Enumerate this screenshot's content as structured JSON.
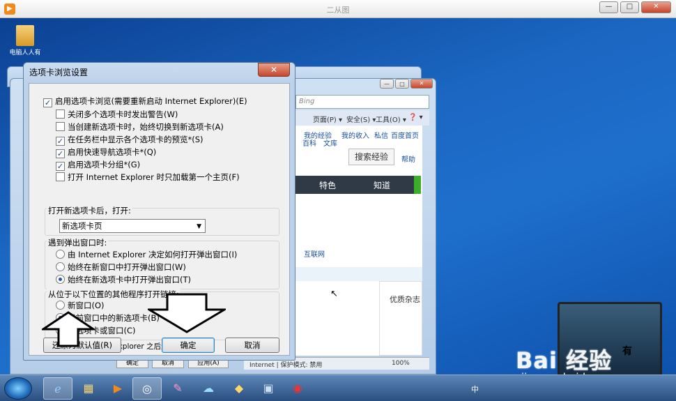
{
  "outer_window": {
    "title": "二从图",
    "min": "—",
    "max": "□",
    "close": "✕"
  },
  "desktop_icon": {
    "label": "电脑人人有"
  },
  "bg_window": {
    "search_hint": "Bing",
    "menu": [
      "页面(P) ▾",
      "安全(S) ▾",
      "工具(O) ▾",
      "❓ ▾"
    ],
    "links": [
      "我的经验",
      "我的收入",
      "私信",
      "百度首页",
      "百科",
      "文库"
    ],
    "search_button": "搜索经验",
    "help": "帮助",
    "nav": [
      "特色",
      "知道"
    ],
    "link_text": "互联网",
    "card_text": "优质杂志",
    "status": "Internet | 保护模式: 禁用",
    "zoom": "100%",
    "bottom_buttons": [
      "确定",
      "取消",
      "应用(A)"
    ]
  },
  "dialog": {
    "title": "选项卡浏览设置",
    "close": "✕",
    "main_checkbox": "启用选项卡浏览(需要重新启动 Internet Explorer)(E)",
    "options": [
      {
        "label": "关闭多个选项卡时发出警告(W)",
        "checked": false
      },
      {
        "label": "当创建新选项卡时，始终切换到新选项卡(A)",
        "checked": false
      },
      {
        "label": "在任务栏中显示各个选项卡的预览*(S)",
        "checked": true
      },
      {
        "label": "启用快速导航选项卡*(Q)",
        "checked": true
      },
      {
        "label": "启用选项卡分组*(G)",
        "checked": true
      },
      {
        "label": "打开 Internet Explorer 时只加载第一个主页(F)",
        "checked": false
      }
    ],
    "new_tab_group": "打开新选项卡后，打开:",
    "new_tab_select": "新选项卡页",
    "popup_group": "遇到弹出窗口时:",
    "popup_options": [
      {
        "label": "由 Internet Explorer 决定如何打开弹出窗口(I)",
        "selected": false
      },
      {
        "label": "始终在新窗口中打开弹出窗口(W)",
        "selected": false
      },
      {
        "label": "始终在新选项卡中打开弹出窗口(T)",
        "selected": true
      }
    ],
    "links_group": "从位于以下位置的其他程序打开链接:",
    "links_options": [
      {
        "label": "新窗口(O)",
        "selected": false
      },
      {
        "label": "当前窗口中的新选项卡(B)",
        "selected": true
      },
      {
        "label": "新选项卡或窗口(C)",
        "selected": false
      }
    ],
    "note": "* 重新启动 Internet Explorer 之后生效",
    "restore_button": "还原为默认值(R)",
    "ok_button": "确定",
    "cancel_button": "取消"
  },
  "gadget_text": "有",
  "watermark": {
    "main": "Bai 经验",
    "sub": "jingyan.baidu.com"
  },
  "taskbar": {
    "tray_text": "中"
  },
  "colors": {
    "accent": "#2a56a8",
    "titlebar": "#bcd1ea",
    "close": "#c7452c"
  }
}
